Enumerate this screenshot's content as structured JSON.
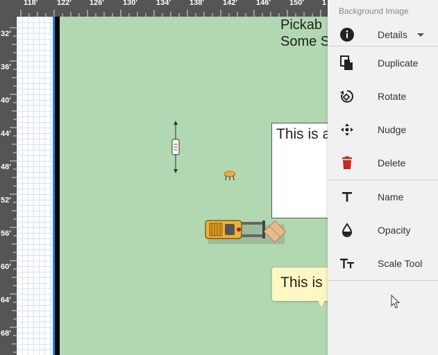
{
  "ruler": {
    "top_ticks": [
      "118'",
      "122'",
      "126'",
      "130'",
      "134'",
      "138'",
      "142'",
      "146'",
      "150'",
      "1"
    ],
    "left_ticks": [
      "32'",
      "36'",
      "40'",
      "44'",
      "48'",
      "52'",
      "56'",
      "60'",
      "64'",
      "68'"
    ]
  },
  "canvas": {
    "top_label": "Pickab\nSome S",
    "text_box": "This is a",
    "callout": "This is"
  },
  "menu": {
    "header": "Background Image",
    "details_label": "Details",
    "items": [
      {
        "label": "Duplicate",
        "icon": "duplicate-icon"
      },
      {
        "label": "Rotate",
        "icon": "rotate-icon"
      },
      {
        "label": "Nudge",
        "icon": "nudge-icon"
      },
      {
        "label": "Delete",
        "icon": "delete-icon"
      },
      {
        "label": "Name",
        "icon": "text-t-icon"
      },
      {
        "label": "Opacity",
        "icon": "opacity-drop-icon"
      },
      {
        "label": "Scale Tool",
        "icon": "scale-tool-icon"
      }
    ]
  },
  "colors": {
    "canvas_green": "#b2d8b2",
    "ruler_gray": "#555555",
    "delete_red": "#c62828",
    "callout_yellow": "#fff8c4"
  }
}
